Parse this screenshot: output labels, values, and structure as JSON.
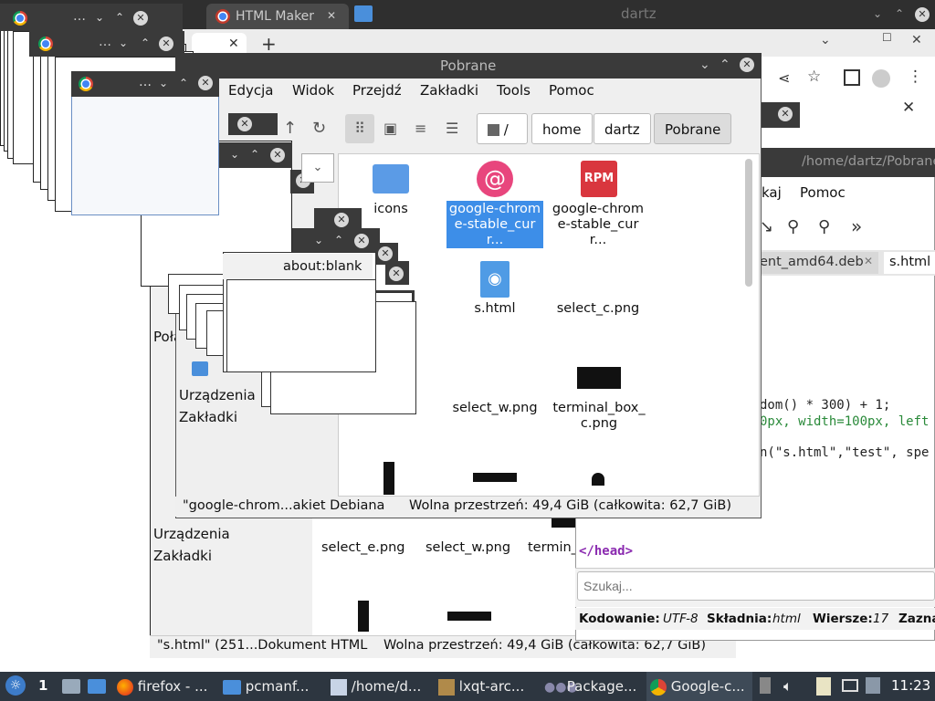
{
  "top_bar": {
    "tab_html": "HTML Maker",
    "user": "dartz"
  },
  "browser": {
    "new_tab": "+"
  },
  "blank_tab": {
    "label": "about:blank"
  },
  "pcmanfm": {
    "title": "Pobrane",
    "menu": [
      "Edycja",
      "Widok",
      "Przejdź",
      "Zakładki",
      "Tools",
      "Pomoc"
    ],
    "breadcrumb": [
      "/",
      "home",
      "dartz",
      "Pobrane"
    ],
    "files": [
      {
        "name": "icons",
        "icon": "folder-icon"
      },
      {
        "name": "google-chrome-stable_curr...",
        "icon": "debian-package-icon",
        "selected": true
      },
      {
        "name": "google-chrome-stable_curr...",
        "icon": "rpm-package-icon"
      },
      {
        "name": "s.html",
        "icon": "html-file-icon"
      },
      {
        "name": "select_c.png",
        "icon": "image-icon"
      },
      {
        "name": "select_w.png",
        "icon": "image-icon"
      },
      {
        "name": "terminal_box_c.png",
        "icon": "black-image-icon"
      }
    ],
    "status_file": "\"google-chrom...akiet Debiana",
    "status_free": "Wolna przestrzeń: 49,4 GiB (całkowita: 62,7 GiB)"
  },
  "pcmanfm_back": {
    "sidebar": {
      "partial": "Połą",
      "devices": "Urządzenia",
      "bookmarks": "Zakładki",
      "dev_front": "Urządzenia",
      "bm_front": "Zakładki"
    },
    "files": [
      "select_e.png",
      "select_w.png",
      "termin_c.p"
    ],
    "status_file": "\"s.html\" (251...Dokument HTML",
    "status_free": "Wolna przestrzeń: 49,4 GiB (całkowita: 62,7 GiB)"
  },
  "editor": {
    "title": "/home/dartz/Pobrane",
    "menu": [
      "kaj",
      "Pomoc"
    ],
    "tabs": [
      "ent_amd64.deb",
      "s.html"
    ],
    "code": [
      {
        "text": "dom() * 300) + 1;",
        "italic_prefix": "dom"
      },
      {
        "text": "0px, width=100px, left"
      },
      {
        "text": "n(\"s.html\",\"test\", spe"
      }
    ],
    "head_tag": "</head>",
    "search_placeholder": "Szukaj...",
    "status": {
      "enc_label": "Kodowanie:",
      "enc": "UTF-8",
      "syn_label": "Składnia:",
      "syn": "html",
      "lines_label": "Wiersze:",
      "lines": "17",
      "sel_label": "Zazna"
    }
  },
  "taskbar": {
    "workspace": "1",
    "items": [
      {
        "label": "firefox - ...",
        "icon": "firefox-icon"
      },
      {
        "label": "pcmanf...",
        "icon": "folder-icon"
      },
      {
        "label": "/home/d...",
        "icon": "editor-icon"
      },
      {
        "label": "lxqt-arc...",
        "icon": "archive-icon"
      },
      {
        "label": "Package...",
        "icon": "package-icon"
      },
      {
        "label": "Google-c...",
        "icon": "chrome-icon"
      }
    ],
    "clock": "11:23"
  }
}
